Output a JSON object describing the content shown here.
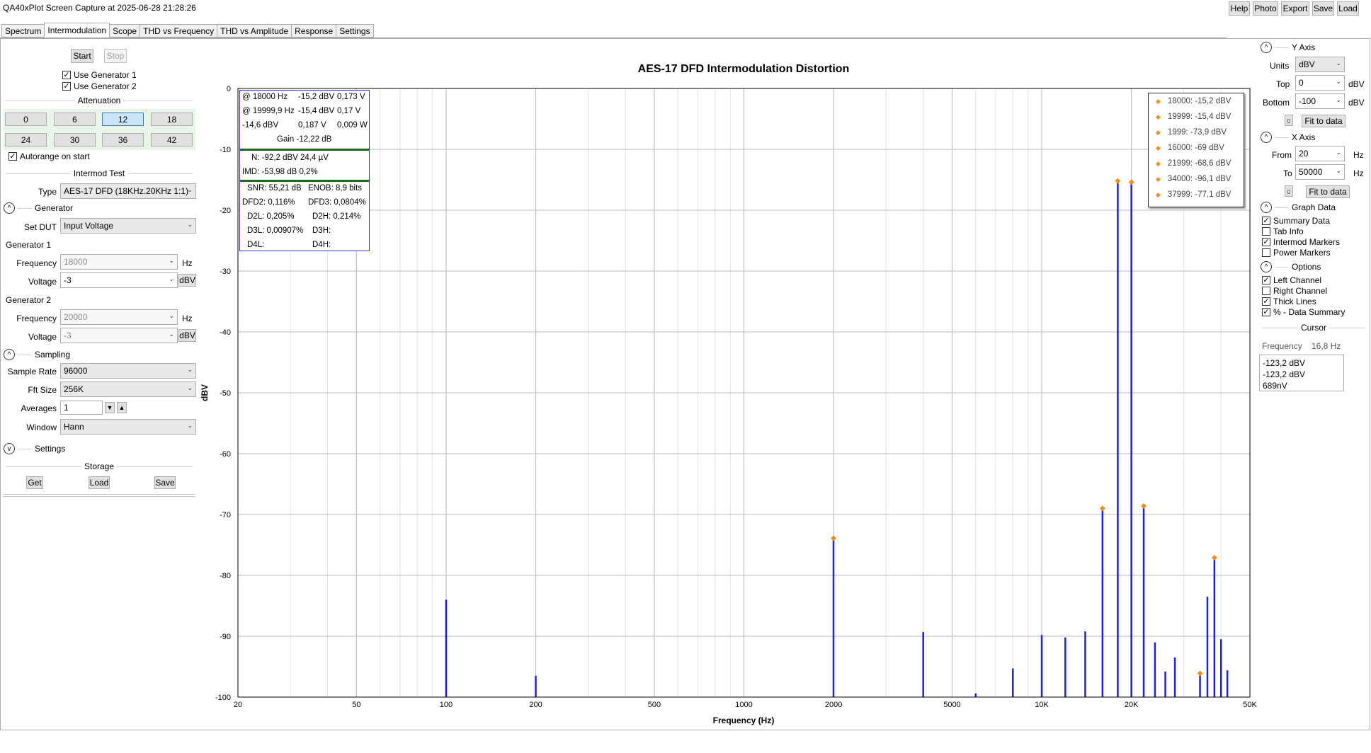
{
  "window": {
    "title": "QA40xPlot Screen Capture at 2025-06-28 21:28:26",
    "top_buttons": [
      "Help",
      "Photo",
      "Export",
      "Save",
      "Load"
    ]
  },
  "tabs": [
    "Spectrum",
    "Intermodulation",
    "Scope",
    "THD vs Frequency",
    "THD vs Amplitude",
    "Response",
    "Settings"
  ],
  "active_tab": "Intermodulation",
  "left_panel": {
    "start_label": "Start",
    "stop_label": "Stop",
    "use_gen1": "Use Generator 1",
    "use_gen2": "Use Generator 2",
    "attenuation_title": "Attenuation",
    "attenuation_values": [
      "0",
      "6",
      "12",
      "18",
      "24",
      "30",
      "36",
      "42"
    ],
    "attenuation_selected": "12",
    "autorange": "Autorange on start",
    "intermod_title": "Intermod Test",
    "type_label": "Type",
    "type_value": "AES-17 DFD (18KHz.20KHz 1:1)",
    "generator_section": "Generator",
    "set_dut_label": "Set DUT",
    "set_dut_value": "Input Voltage",
    "gen1_title": "Generator 1",
    "gen2_title": "Generator 2",
    "frequency_label": "Frequency",
    "voltage_label": "Voltage",
    "gen1_freq": "18000",
    "gen1_volt": "-3",
    "gen2_freq": "20000",
    "gen2_volt": "-3",
    "hz_unit": "Hz",
    "dbv_unit": "dBV",
    "sampling_section": "Sampling",
    "sample_rate_label": "Sample Rate",
    "sample_rate_value": "96000",
    "fft_size_label": "Fft Size",
    "fft_size_value": "256K",
    "averages_label": "Averages",
    "averages_value": "1",
    "window_label": "Window",
    "window_value": "Hann",
    "settings_section": "Settings",
    "storage_title": "Storage",
    "get_label": "Get",
    "load_label": "Load",
    "save_label": "Save"
  },
  "info_box": {
    "line1a": "@ 18000 Hz",
    "line1b": "-15,2 dBV",
    "line1c": "0,173 V",
    "line2a": "@ 19999,9 Hz",
    "line2b": "-15,4 dBV",
    "line2c": "0,17 V",
    "line3a": "-14,6 dBV",
    "line3b": "0,187 V",
    "line3c": "0,009 W",
    "gain": "Gain -12,22 dB",
    "noise": "N: -92,2 dBV 24,4 µV",
    "imd": "IMD: -53,98 dB 0,2%",
    "snr": "SNR: 55,21 dB",
    "enob": "ENOB: 8,9 bits",
    "dfd2": "DFD2: 0,116%",
    "dfd3": "DFD3: 0,0804%",
    "d2l": "D2L: 0,205%",
    "d2h": "D2H: 0,214%",
    "d3l": "D3L: 0,00907%",
    "d3h": "D3H:",
    "d4l": "D4L:",
    "d4h": "D4H:"
  },
  "legend": [
    "18000: -15,2 dBV",
    "19999: -15,4 dBV",
    "1999: -73,9 dBV",
    "16000: -69 dBV",
    "21999: -68,6 dBV",
    "34000: -96,1 dBV",
    "37999: -77,1 dBV"
  ],
  "right_panel": {
    "y_axis_title": "Y Axis",
    "units_label": "Units",
    "units_value": "dBV",
    "top_label": "Top",
    "top_value": "0",
    "bottom_label": "Bottom",
    "bottom_value": "-100",
    "unit_dbv": "dBV",
    "fit_to_data": "Fit to data",
    "x_axis_title": "X Axis",
    "from_label": "From",
    "from_value": "20",
    "to_label": "To",
    "to_value": "50000",
    "unit_hz": "Hz",
    "graph_data_title": "Graph Data",
    "graph_checks": [
      {
        "label": "Summary Data",
        "checked": true
      },
      {
        "label": "Tab Info",
        "checked": false
      },
      {
        "label": "Intermod Markers",
        "checked": true
      },
      {
        "label": "Power Markers",
        "checked": false
      }
    ],
    "options_title": "Options",
    "option_checks": [
      {
        "label": "Left Channel",
        "checked": true
      },
      {
        "label": "Right Channel",
        "checked": false
      },
      {
        "label": "Thick Lines",
        "checked": true
      },
      {
        "label": "% - Data Summary",
        "checked": true
      }
    ],
    "cursor_title": "Cursor",
    "cursor_freq_label": "Frequency",
    "cursor_freq_value": "16,8 Hz",
    "cursor_lines": [
      "-123,2 dBV",
      "-123,2 dBV",
      "689nV"
    ]
  },
  "chart_data": {
    "type": "line",
    "title": "AES-17 DFD  Intermodulation Distortion",
    "xlabel": "Frequency (Hz)",
    "ylabel": "dBV",
    "x_scale": "log",
    "xlim": [
      20,
      50000
    ],
    "ylim": [
      -100,
      0
    ],
    "x_ticks": [
      {
        "v": 20,
        "label": "20"
      },
      {
        "v": 50,
        "label": "50"
      },
      {
        "v": 100,
        "label": "100"
      },
      {
        "v": 200,
        "label": "200"
      },
      {
        "v": 500,
        "label": "500"
      },
      {
        "v": 1000,
        "label": "1000"
      },
      {
        "v": 2000,
        "label": "2000"
      },
      {
        "v": 5000,
        "label": "5000"
      },
      {
        "v": 10000,
        "label": "10K"
      },
      {
        "v": 20000,
        "label": "20K"
      },
      {
        "v": 50000,
        "label": "50K"
      }
    ],
    "y_ticks": [
      0,
      -10,
      -20,
      -30,
      -40,
      -50,
      -60,
      -70,
      -80,
      -90,
      -100
    ],
    "grid": true,
    "spectrum_lines": [
      {
        "x": 100,
        "y": -84
      },
      {
        "x": 200,
        "y": -96.5
      },
      {
        "x": 1999,
        "y": -74
      },
      {
        "x": 4000,
        "y": -89.3
      },
      {
        "x": 6000,
        "y": -99.4
      },
      {
        "x": 8000,
        "y": -95.3
      },
      {
        "x": 10000,
        "y": -89.8
      },
      {
        "x": 12000,
        "y": -90.2
      },
      {
        "x": 14000,
        "y": -89.2
      },
      {
        "x": 16000,
        "y": -69
      },
      {
        "x": 18000,
        "y": -15.2
      },
      {
        "x": 19999,
        "y": -15.4
      },
      {
        "x": 21999,
        "y": -68.6
      },
      {
        "x": 24000,
        "y": -91
      },
      {
        "x": 26000,
        "y": -95.8
      },
      {
        "x": 28000,
        "y": -93.5
      },
      {
        "x": 34000,
        "y": -96.1
      },
      {
        "x": 36000,
        "y": -83.5
      },
      {
        "x": 37999,
        "y": -77.1
      },
      {
        "x": 40000,
        "y": -90.5
      },
      {
        "x": 42000,
        "y": -95.6
      }
    ],
    "markers": [
      {
        "x": 18000,
        "y": -15.2
      },
      {
        "x": 19999,
        "y": -15.4
      },
      {
        "x": 1999,
        "y": -73.9
      },
      {
        "x": 16000,
        "y": -69
      },
      {
        "x": 21999,
        "y": -68.6
      },
      {
        "x": 34000,
        "y": -96.1
      },
      {
        "x": 37999,
        "y": -77.1
      }
    ],
    "line_color": "#1f1fe0",
    "marker_color": "#f28e1c"
  }
}
